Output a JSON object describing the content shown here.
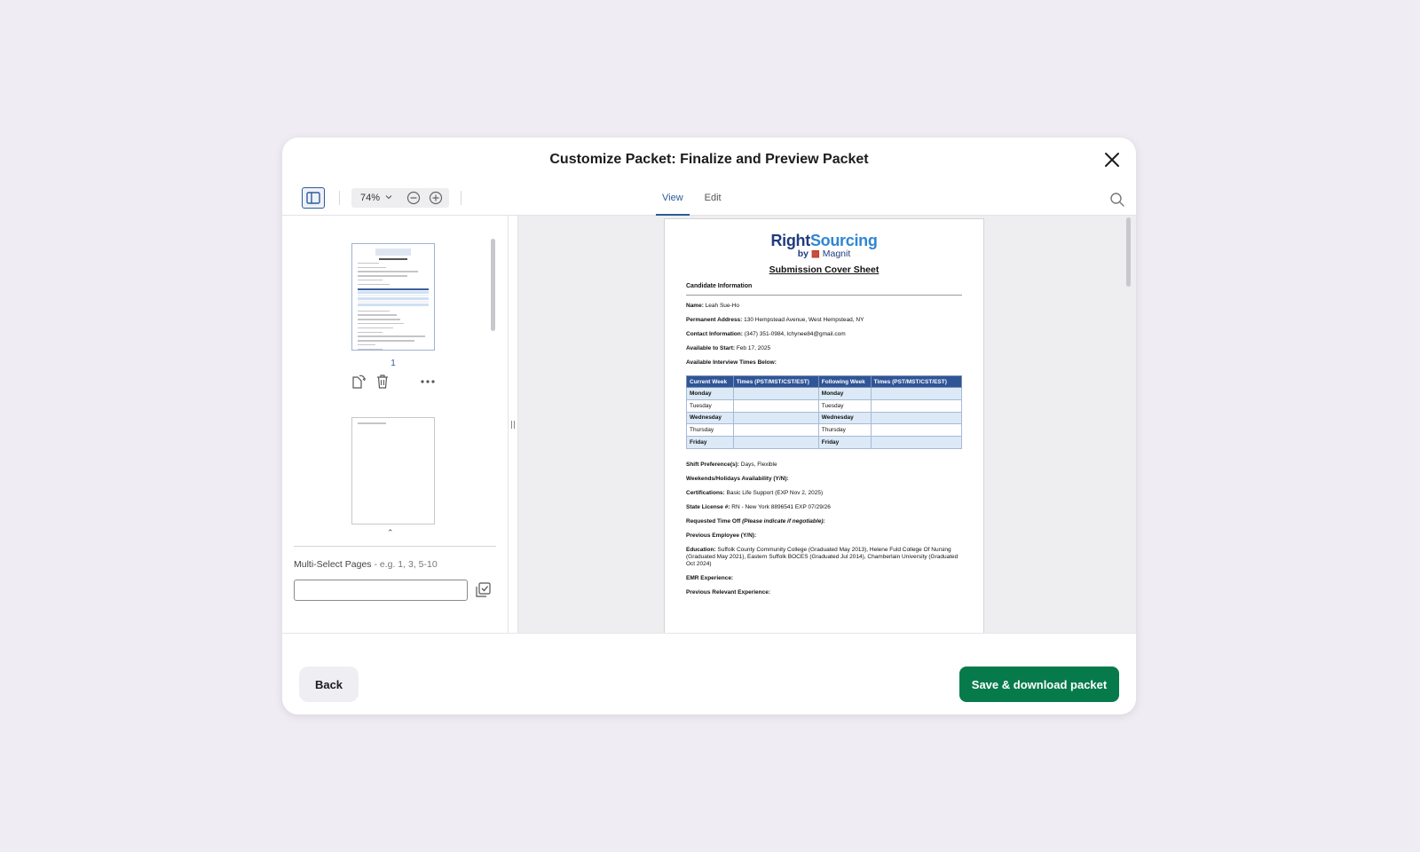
{
  "modal": {
    "title": "Customize Packet: Finalize and Preview Packet"
  },
  "toolbar": {
    "zoom": "74%",
    "tabs": [
      {
        "label": "View",
        "active": true
      },
      {
        "label": "Edit",
        "active": false
      }
    ]
  },
  "sidebar": {
    "current_page": "1",
    "multiselect_label": "Multi-Select Pages",
    "multiselect_hint": " - e.g. 1, 3, 5-10",
    "multiselect_value": ""
  },
  "document": {
    "logo_main_a": "Right",
    "logo_main_b": "Sourcing",
    "logo_sub_a": "by ",
    "logo_sub_b": "Magnit",
    "title": "Submission Cover Sheet",
    "section": "Candidate Information",
    "name_label": "Name:",
    "name_value": " Leah Sue-Ho",
    "address_label": "Permanent Address:",
    "address_value": "  130 Hempstead Avenue, West Hempstead, NY",
    "contact_label": "Contact Information:",
    "contact_value": "  (347) 351-0984, lchynee84@gmail.com",
    "start_label": "Available to Start:",
    "start_value": " Feb 17, 2025",
    "interview_label": "Available Interview Times Below:",
    "table_headers": [
      "Current Week",
      "Times (PST/MST/CST/EST)",
      "Following Week",
      "Times (PST/MST/CST/EST)"
    ],
    "table_rows": [
      [
        "Monday",
        "",
        "Monday",
        ""
      ],
      [
        "Tuesday",
        "",
        "Tuesday",
        ""
      ],
      [
        "Wednesday",
        "",
        "Wednesday",
        ""
      ],
      [
        "Thursday",
        "",
        "Thursday",
        ""
      ],
      [
        "Friday",
        "",
        "Friday",
        ""
      ]
    ],
    "shift_label": "Shift Preference(s):",
    "shift_value": " Days, Flexible",
    "weekends_label": "Weekends/Holidays Availability (Y/N):",
    "cert_label": "Certifications:",
    "cert_value": " Basic Life Support (EXP Nov 2, 2025)",
    "license_label": "State License #:",
    "license_value": " RN - New York 8896541 EXP 07/29/26",
    "timeoff_label": "Requested Time Off ",
    "timeoff_note": "(Please indicate if negotiable):",
    "prev_emp_label": "Previous Employee (Y/N):",
    "education_label": "Education:",
    "education_value": " Suffolk County Community College (Graduated May 2013), Helene Fuld College Of Nursing (Graduated May 2021), Eastern Suffolk BOCES (Graduated Jul 2014), Chamberlain University (Graduated Oct 2024)",
    "emr_label": "EMR Experience:",
    "prev_rel_label": "Previous Relevant Experience:"
  },
  "footer": {
    "back_label": "Back",
    "save_label": "Save & download packet"
  },
  "colors": {
    "primary": "#067a4b",
    "accent": "#2a5c9a",
    "table_header": "#2f5597",
    "table_shade": "#dceaf7"
  },
  "icons": [
    "close-icon",
    "sidebar-toggle-icon",
    "chevron-down-icon",
    "zoom-out-icon",
    "zoom-in-icon",
    "search-icon",
    "rotate-page-icon",
    "trash-icon",
    "more-icon",
    "apply-selection-icon"
  ]
}
